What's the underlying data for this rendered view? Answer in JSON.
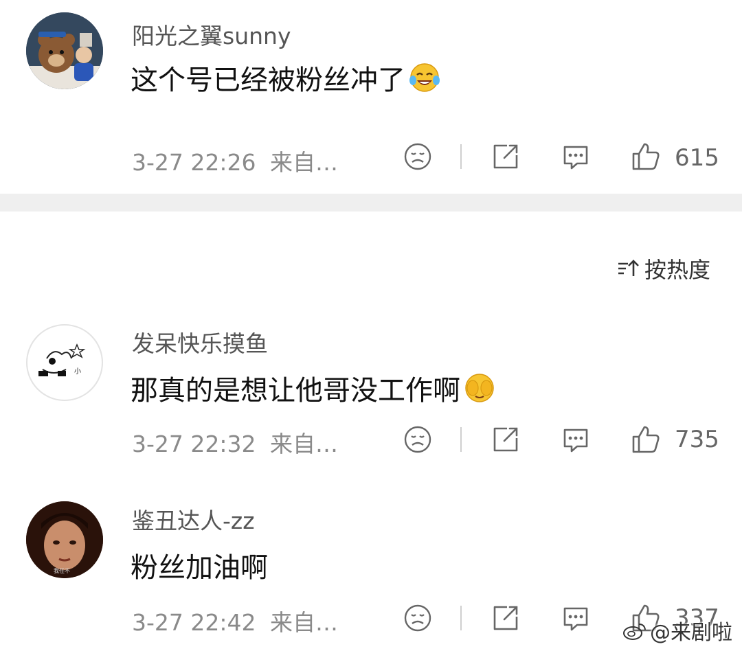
{
  "comments": [
    {
      "username": "阳光之翼sunny",
      "text": "这个号已经被粉丝冲了",
      "emoji": "laugh-cry-emoji",
      "time": "3-27 22:26",
      "source": "来自…",
      "likes": "615"
    },
    {
      "username": "发呆快乐摸鱼",
      "text": "那真的是想让他哥没工作啊",
      "emoji": "cover-face-emoji",
      "time": "3-27 22:32",
      "source": "来自…",
      "likes": "735"
    },
    {
      "username": "鉴丑达人-zz",
      "text": "粉丝加油啊",
      "emoji": "",
      "time": "3-27 22:42",
      "source": "来自…",
      "likes": "337"
    }
  ],
  "sort": {
    "label": "按热度"
  },
  "watermark": {
    "text": "@来剧啦"
  },
  "colors": {
    "divider": "#efefef",
    "meta": "#8a8a8a",
    "icon": "#666666"
  }
}
